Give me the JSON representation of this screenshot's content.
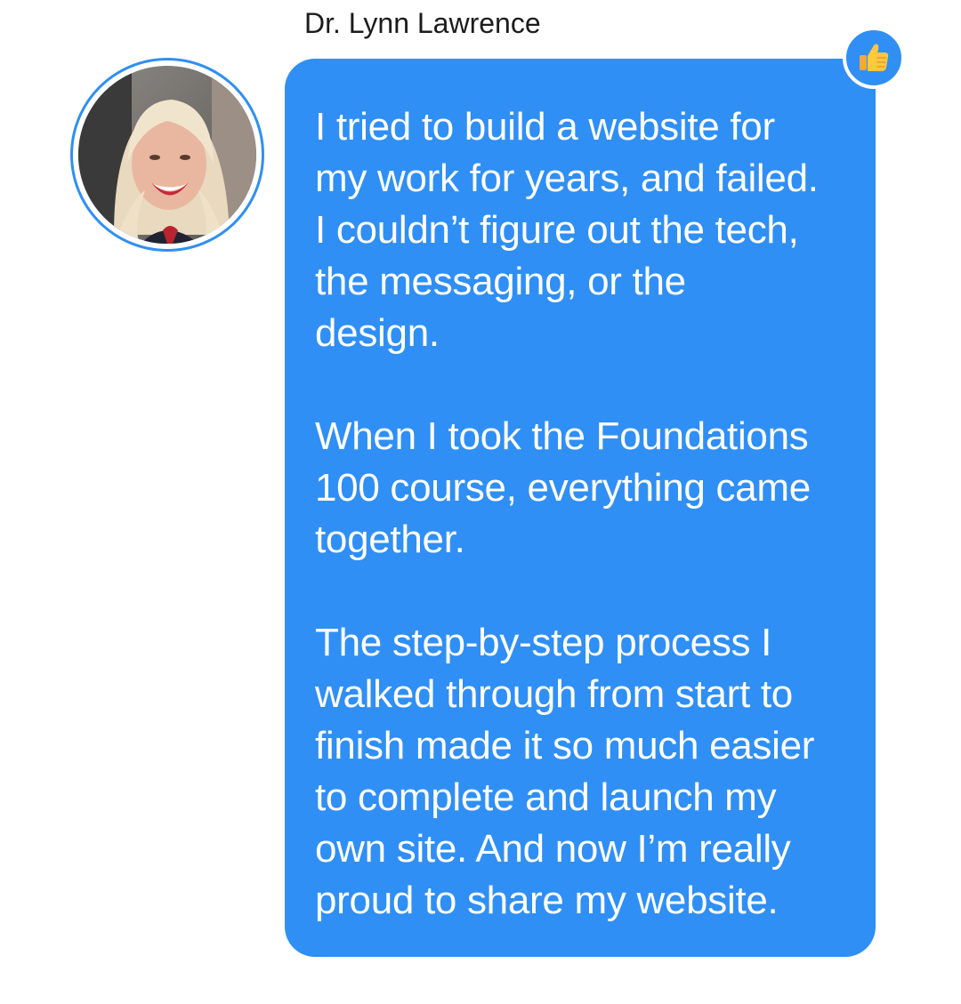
{
  "message": {
    "sender_name": "Dr. Lynn Lawrence",
    "paragraphs": [
      "I tried to build a website for\nmy work for years, and failed.\nI couldn’t figure out the tech,\nthe messaging, or the\ndesign.",
      "When I took the Foundations\n100 course, everything came\ntogether.",
      "The step-by-step process I\nwalked through from start to\nfinish made it so much easier\nto complete and launch my\nown site. And now I’m really\nproud to share my website."
    ],
    "reaction_icon": "thumbs-up-icon"
  },
  "colors": {
    "bubble": "#2f8ff5",
    "bubble_text": "#ffffff",
    "name_text": "#1c1c1c",
    "reaction": "#ffc83d"
  }
}
